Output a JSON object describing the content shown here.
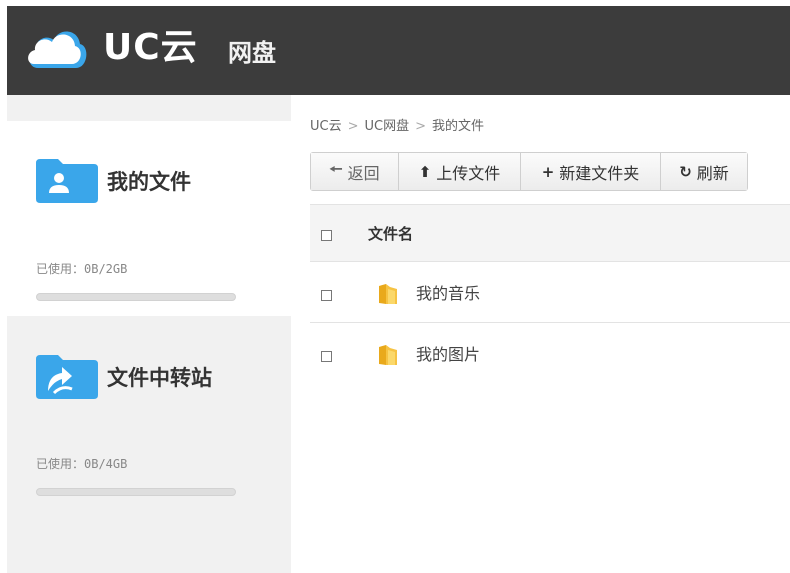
{
  "header": {
    "brand": "UC云",
    "sub": "网盘",
    "icon": "cloud-logo-icon"
  },
  "sidebar": {
    "items": [
      {
        "title": "我的文件",
        "usage": "已使用：0B/2GB",
        "progress": 0,
        "icon": "user-folder-icon",
        "color": "#3aa6ea"
      },
      {
        "title": "文件中转站",
        "usage": "已使用：0B/4GB",
        "progress": 0,
        "icon": "transfer-folder-icon",
        "color": "#3aa6ea"
      }
    ]
  },
  "breadcrumb": {
    "items": [
      "UC云",
      "UC网盘",
      "我的文件"
    ],
    "separator": ">"
  },
  "toolbar": {
    "back": {
      "icon": "arrow-left-icon",
      "label": "返回"
    },
    "upload": {
      "icon": "upload-icon",
      "label": "上传文件"
    },
    "new_folder": {
      "icon": "plus-icon",
      "label": "新建文件夹"
    },
    "refresh": {
      "icon": "refresh-icon",
      "label": "刷新"
    }
  },
  "table": {
    "header": "文件名",
    "rows": [
      {
        "name": "我的音乐",
        "icon": "folder-icon"
      },
      {
        "name": "我的图片",
        "icon": "folder-icon"
      }
    ]
  },
  "colors": {
    "header_bg": "#3c3c3c",
    "accent": "#3aa6ea",
    "folder": "#e9a91b"
  }
}
